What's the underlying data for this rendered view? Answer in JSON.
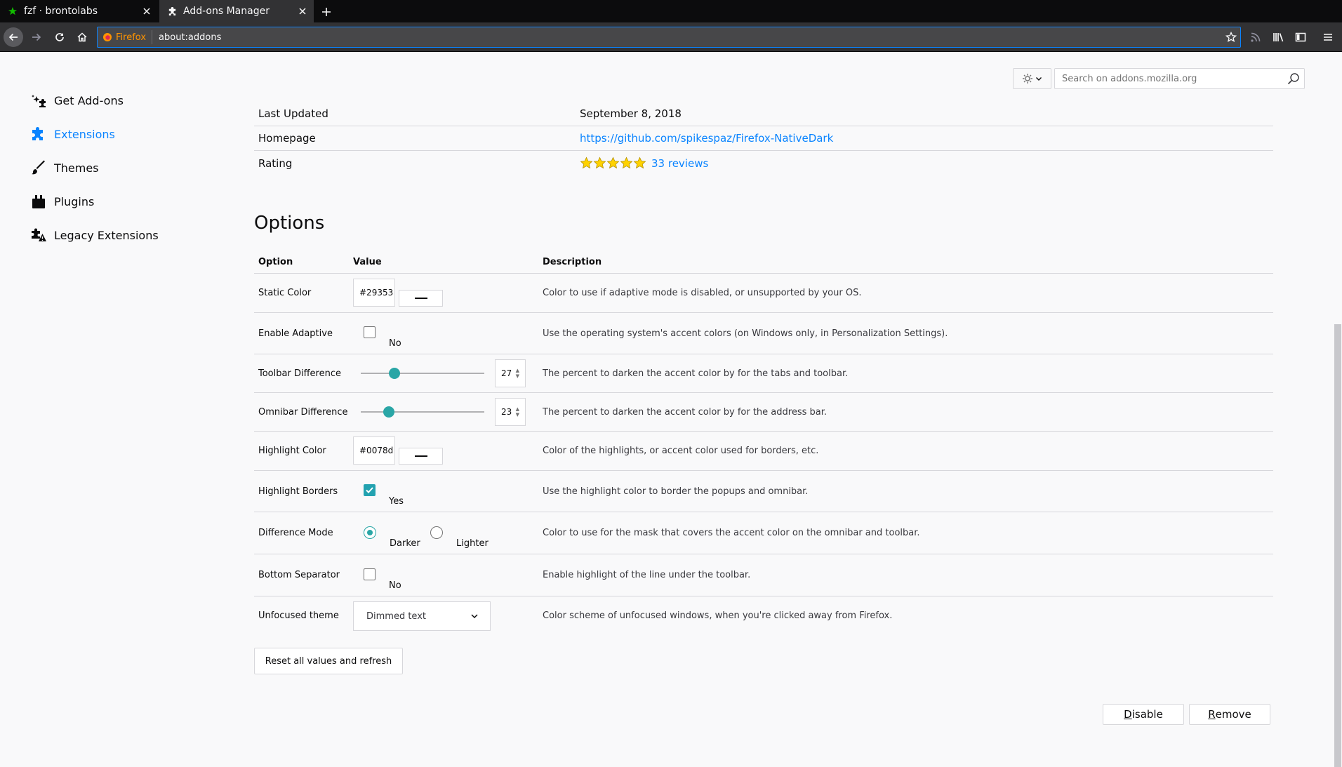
{
  "browser": {
    "tabs": [
      {
        "label": "fzf · brontolabs"
      },
      {
        "label": "Add-ons Manager"
      }
    ],
    "identity_label": "Firefox",
    "url": "about:addons"
  },
  "sidebar": {
    "items": [
      {
        "label": "Get Add-ons"
      },
      {
        "label": "Extensions"
      },
      {
        "label": "Themes"
      },
      {
        "label": "Plugins"
      },
      {
        "label": "Legacy Extensions"
      }
    ]
  },
  "search": {
    "placeholder": "Search on addons.mozilla.org"
  },
  "details": {
    "last_updated_label": "Last Updated",
    "last_updated_value": "September 8, 2018",
    "homepage_label": "Homepage",
    "homepage_value": "https://github.com/spikespaz/Firefox-NativeDark",
    "rating_label": "Rating",
    "rating_value": 5,
    "reviews_text": "33 reviews"
  },
  "options": {
    "title": "Options",
    "headers": {
      "option": "Option",
      "value": "Value",
      "description": "Description"
    },
    "static_color": {
      "name": "Static Color",
      "value": "#29353",
      "description": "Color to use if adaptive mode is disabled, or unsupported by your OS."
    },
    "enable_adaptive": {
      "name": "Enable Adaptive",
      "checked": false,
      "state_label": "No",
      "description": "Use the operating system's accent colors (on Windows only, in Personalization Settings)."
    },
    "toolbar_difference": {
      "name": "Toolbar Difference",
      "value": "27",
      "slider_fraction": 0.27,
      "description": "The percent to darken the accent color by for the tabs and toolbar."
    },
    "omnibar_difference": {
      "name": "Omnibar Difference",
      "value": "23",
      "slider_fraction": 0.23,
      "description": "The percent to darken the accent color by for the address bar."
    },
    "highlight_color": {
      "name": "Highlight Color",
      "value": "#0078d",
      "description": "Color of the highlights, or accent color used for borders, etc."
    },
    "highlight_borders": {
      "name": "Highlight Borders",
      "checked": true,
      "state_label": "Yes",
      "description": "Use the highlight color to border the popups and omnibar."
    },
    "difference_mode": {
      "name": "Difference Mode",
      "options": [
        "Darker",
        "Lighter"
      ],
      "selected": "Darker",
      "description": "Color to use for the mask that covers the accent color on the omnibar and toolbar."
    },
    "bottom_separator": {
      "name": "Bottom Separator",
      "checked": false,
      "state_label": "No",
      "description": "Enable highlight of the line under the toolbar."
    },
    "unfocused_theme": {
      "name": "Unfocused theme",
      "selected": "Dimmed text",
      "description": "Color scheme of unfocused windows, when you're clicked away from Firefox."
    },
    "reset_label": "Reset all values and refresh"
  },
  "actions": {
    "disable_accel": "D",
    "disable_rest": "isable",
    "remove_accel": "R",
    "remove_rest": "emove"
  },
  "colors": {
    "accent": "#0a84ff",
    "control_teal": "#2aa6a6",
    "star_yellow": "#ffd200"
  },
  "icons": {
    "tab1": "star-icon",
    "tab2": "puzzle-icon",
    "identity": "firefox-logo-icon",
    "get_addons": "sparkle-puzzle-icon",
    "extensions": "puzzle-icon",
    "themes": "brush-icon",
    "plugins": "plugin-block-icon",
    "legacy": "warning-puzzle-icon"
  }
}
